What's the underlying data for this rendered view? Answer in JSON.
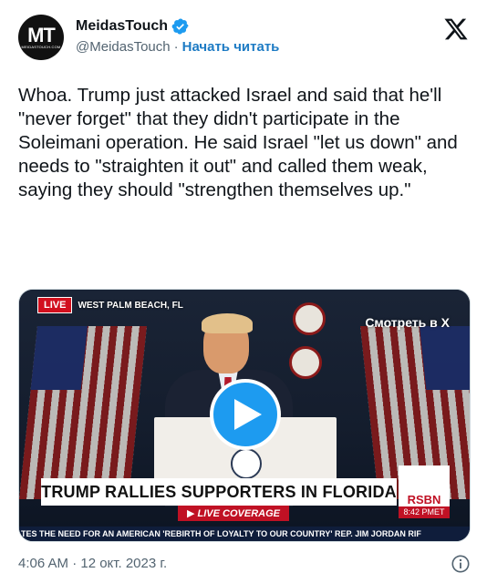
{
  "author": {
    "name": "MeidasTouch",
    "handle": "@MeidasTouch",
    "separator": "·",
    "follow_label": "Начать читать",
    "avatar_text": "MT",
    "avatar_subtext": "MEIDASTOUCH.COM"
  },
  "tweet": {
    "text": "Whoa. Trump just attacked Israel and said that he'll \"never forget\" that they didn't participate in the Soleimani operation. He said Israel \"let us down\" and needs to \"straighten it out\" and called them weak, saying they should \"strengthen themselves up.\""
  },
  "media": {
    "watch_label": "Смотреть в X",
    "live_badge": "LIVE",
    "location": "WEST PALM BEACH, FL",
    "headline": "TRUMP RALLIES SUPPORTERS IN FLORIDA",
    "live_coverage": "▶ LIVE COVERAGE",
    "network": "RSBN",
    "network_time": "8:42 PMET",
    "ticker": "TES THE NEED FOR AN AMERICAN 'REBIRTH OF LOYALTY TO OUR COUNTRY'   REP. JIM JORDAN RIF"
  },
  "footer": {
    "timestamp": "4:06 AM · 12 окт. 2023 г."
  },
  "colors": {
    "accent": "#1d9bf0",
    "link": "#1d7bc4",
    "secondary_text": "#536471",
    "live_red": "#d2101e"
  },
  "icons": {
    "verified": "verified-badge-icon",
    "x_logo": "x-logo-icon",
    "play": "play-icon",
    "info": "info-icon"
  }
}
